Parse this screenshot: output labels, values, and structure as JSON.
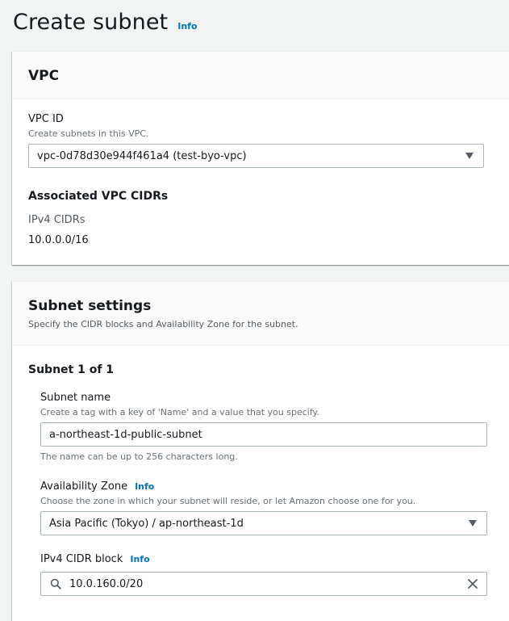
{
  "page": {
    "title": "Create subnet",
    "info_label": "Info"
  },
  "vpc_panel": {
    "title": "VPC",
    "vpc_id_label": "VPC ID",
    "vpc_id_desc": "Create subnets in this VPC.",
    "vpc_id_value": "vpc-0d78d30e944f461a4 (test-byo-vpc)",
    "associated_title": "Associated VPC CIDRs",
    "ipv4_cidrs_label": "IPv4 CIDRs",
    "ipv4_cidrs_value": "10.0.0.0/16"
  },
  "subnet_panel": {
    "title": "Subnet settings",
    "desc": "Specify the CIDR blocks and Availability Zone for the subnet.",
    "subnet_count": "Subnet 1 of 1",
    "subnet_name_label": "Subnet name",
    "subnet_name_desc": "Create a tag with a key of 'Name' and a value that you specify.",
    "subnet_name_value": "a-northeast-1d-public-subnet",
    "subnet_name_hint": "The name can be up to 256 characters long.",
    "az_label": "Availability Zone",
    "az_info": "Info",
    "az_desc": "Choose the zone in which your subnet will reside, or let Amazon choose one for you.",
    "az_value": "Asia Pacific (Tokyo) / ap-northeast-1d",
    "cidr_label": "IPv4 CIDR block",
    "cidr_info": "Info",
    "cidr_value": "10.0.160.0/20"
  },
  "colors": {
    "link": "#0073bb",
    "background": "#f2f3f3",
    "text": "#16191f"
  }
}
